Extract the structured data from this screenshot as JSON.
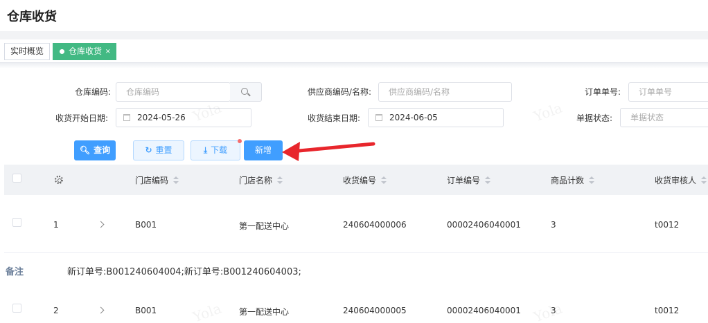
{
  "page": {
    "title": "仓库收货"
  },
  "tabs": [
    {
      "label": "实时概览",
      "active": false
    },
    {
      "label": "仓库收货",
      "active": true,
      "close": "×"
    }
  ],
  "filters": {
    "warehouse_code": {
      "label": "仓库编码:",
      "placeholder": "仓库编码"
    },
    "supplier": {
      "label": "供应商编码/名称:",
      "placeholder": "供应商编码/名称"
    },
    "order_no": {
      "label": "订单单号:",
      "placeholder": "订单单号"
    },
    "start_date": {
      "label": "收货开始日期:",
      "value": "2024-05-26"
    },
    "end_date": {
      "label": "收货结束日期:",
      "value": "2024-06-05"
    },
    "doc_status": {
      "label": "单据状态:",
      "placeholder": "单据状态"
    }
  },
  "actions": {
    "query": "查询",
    "reset": "重置",
    "download": "下载",
    "add": "新增"
  },
  "table": {
    "columns": [
      "门店编码",
      "门店名称",
      "收货编号",
      "订单编号",
      "商品计数",
      "收货审核人"
    ],
    "rows": [
      {
        "index": "1",
        "store_code": "B001",
        "store_name": "第一配送中心",
        "receipt_no": "240604000006",
        "order_no": "00002406040001",
        "item_count": "3",
        "reviewer": "t0012"
      },
      {
        "index": "2",
        "store_code": "B001",
        "store_name": "第一配送中心",
        "receipt_no": "240604000005",
        "order_no": "00002406040001",
        "item_count": "3",
        "reviewer": "t0012"
      }
    ],
    "remark": {
      "label": "备注",
      "text": "新订单号:B001240604004;新订单号:B001240604003;"
    }
  },
  "watermark": "Yola",
  "colors": {
    "primary": "#409eff",
    "active_tab": "#42b983",
    "arrow": "#e8262c"
  }
}
